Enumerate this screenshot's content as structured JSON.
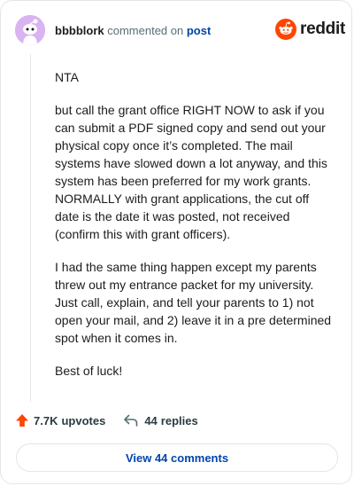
{
  "header": {
    "username": "bbbblork",
    "action_text": "commented on",
    "post_link": "post",
    "logo_text": "reddit"
  },
  "comment": {
    "paragraphs": [
      "NTA",
      "but call the grant office RIGHT NOW to ask if you can submit a PDF signed copy and send out your physical copy once it’s completed. The mail systems have slowed down a lot anyway, and this system has been preferred for my work grants. NORMALLY with grant applications, the cut off date is the date it was posted, not received (confirm this with grant officers).",
      "I had the same thing happen except my parents threw out my entrance packet for my university. Just call, explain, and tell your parents to 1) not open your mail, and 2) leave it in a pre determined spot when it comes in.",
      "Best of luck!"
    ]
  },
  "actions": {
    "upvotes_count": "7.7K",
    "upvotes_label": "upvotes",
    "replies_count": "44",
    "replies_label": "replies",
    "view_button": "View 44 comments"
  },
  "colors": {
    "upvote": "#ff4500",
    "link": "#0045ac",
    "avatar_bg": "#d9b4f0"
  }
}
